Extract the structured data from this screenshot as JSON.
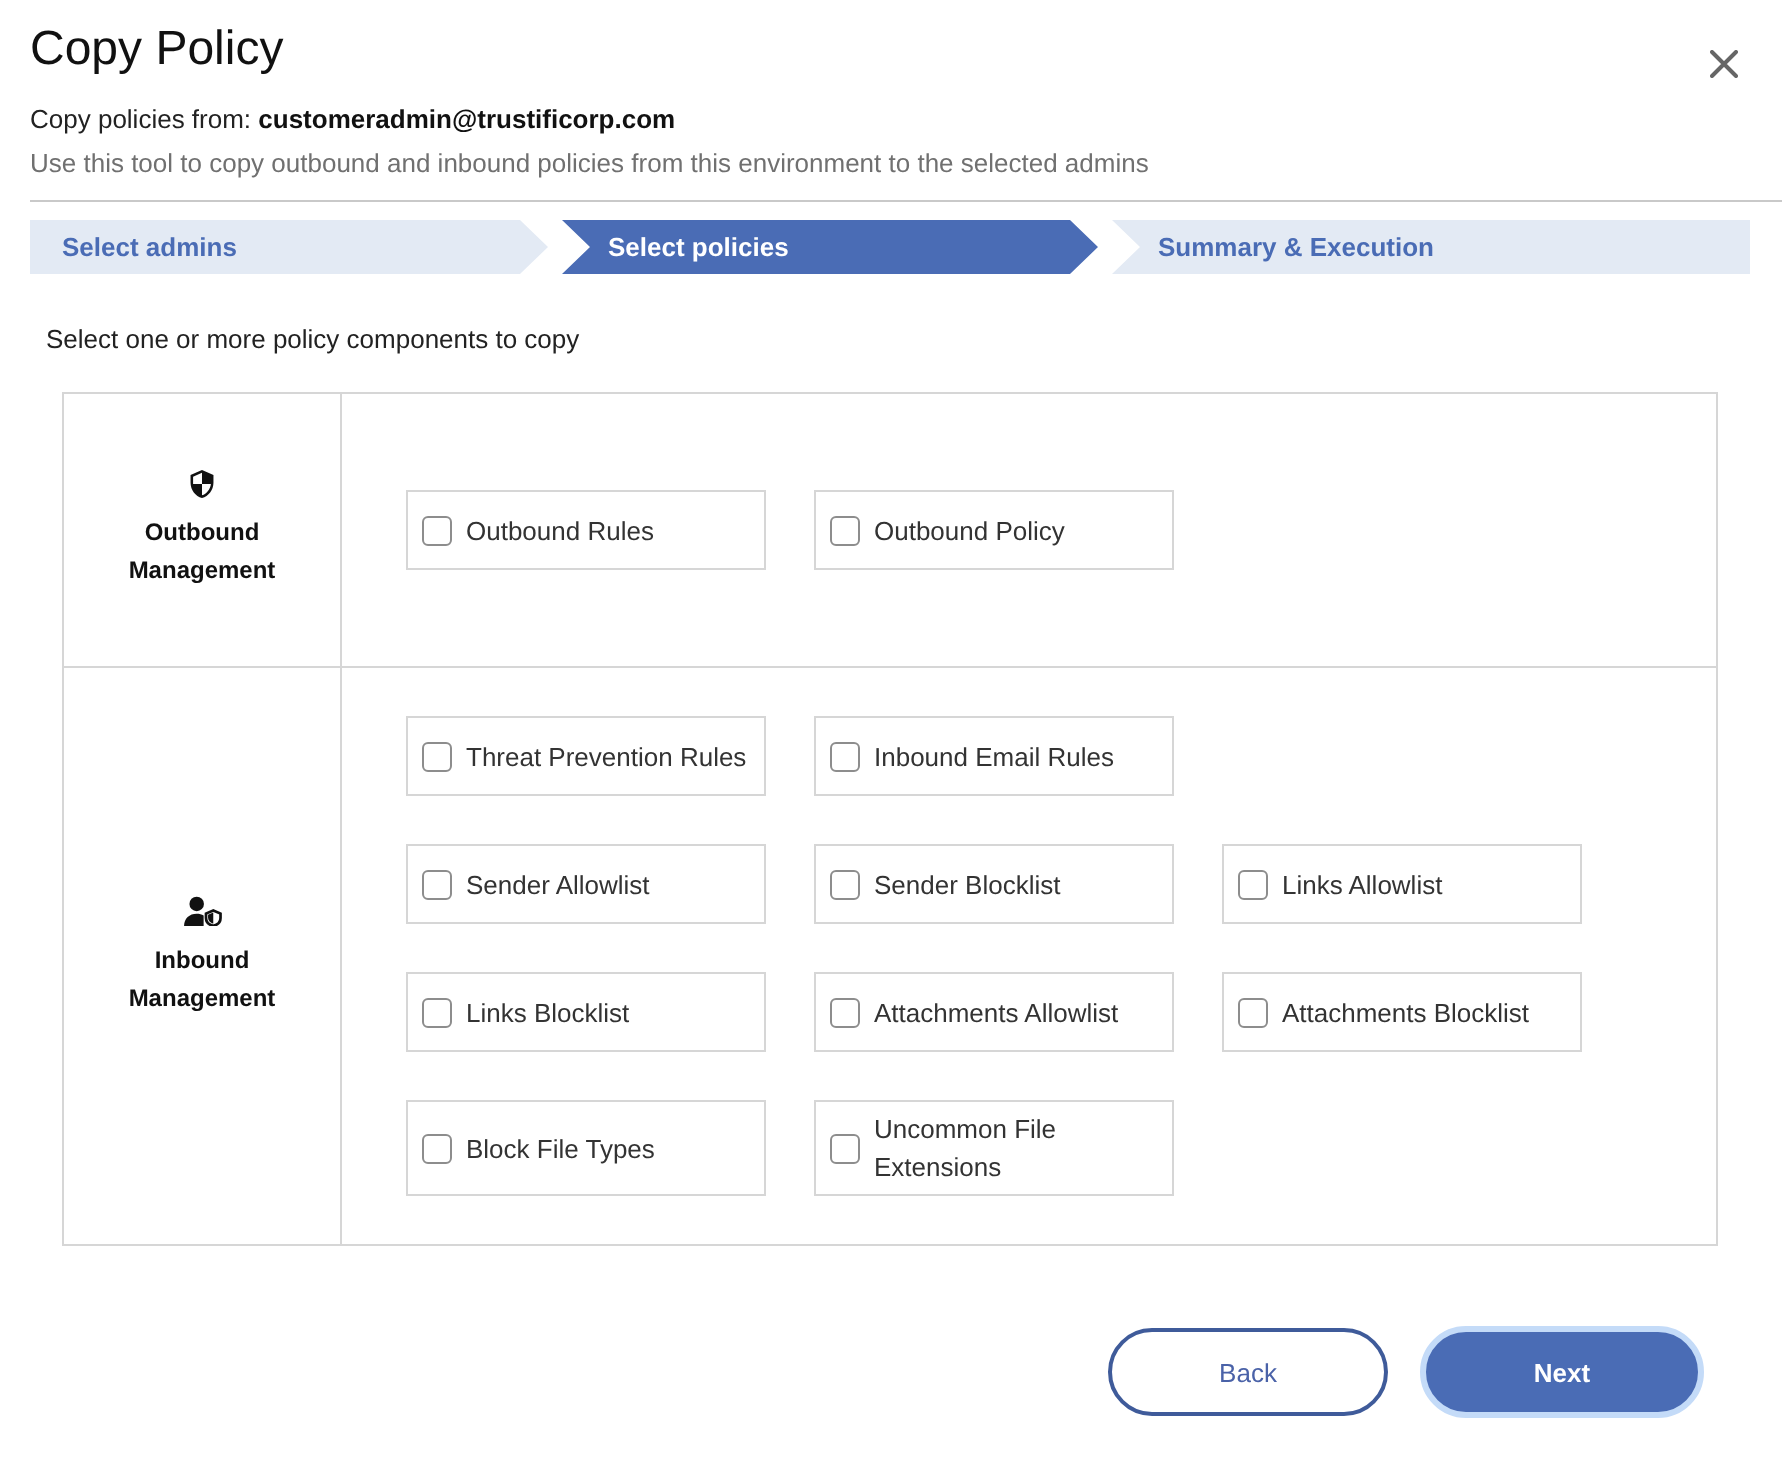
{
  "dialog": {
    "title": "Copy Policy",
    "source": "Copy policies from: **customeradmin@trustificorp.com**",
    "description": "Use this tool to copy outbound and inbound policies from this environment to the selected admins"
  },
  "steps": [
    {
      "label": "Select admins",
      "selected": false
    },
    {
      "label": "Select policies",
      "selected": true
    },
    {
      "label": "Summary & Execution",
      "selected": false
    }
  ],
  "instruction": "Select one or more policy components to copy",
  "sections": [
    {
      "kind": "outbound",
      "label": "Outbound Management",
      "rows": [
        [
          {
            "label": "Outbound Rules",
            "checked": false
          },
          {
            "label": "Outbound Policy",
            "checked": false
          }
        ]
      ]
    },
    {
      "kind": "inbound",
      "label": "Inbound Management",
      "rows": [
        [
          {
            "label": "Threat Prevention Rules",
            "checked": false
          },
          {
            "label": "Inbound Email Rules",
            "checked": false
          }
        ],
        [
          {
            "label": "Sender Allowlist",
            "checked": false
          },
          {
            "label": "Sender Blocklist",
            "checked": false
          },
          {
            "label": "Links Allowlist",
            "checked": false
          }
        ],
        [
          {
            "label": "Links Blocklist",
            "checked": false
          },
          {
            "label": "Attachments Allowlist",
            "checked": false
          },
          {
            "label": "Attachments Blocklist",
            "checked": false
          }
        ],
        [
          {
            "label": "Block File Types",
            "checked": false
          },
          {
            "label": "Uncommon File Extensions",
            "checked": false
          }
        ]
      ]
    }
  ],
  "buttons": [
    {
      "label": "Back",
      "kind": "secondary",
      "focused": false
    },
    {
      "label": "Next",
      "kind": "primary",
      "focused": true
    }
  ]
}
